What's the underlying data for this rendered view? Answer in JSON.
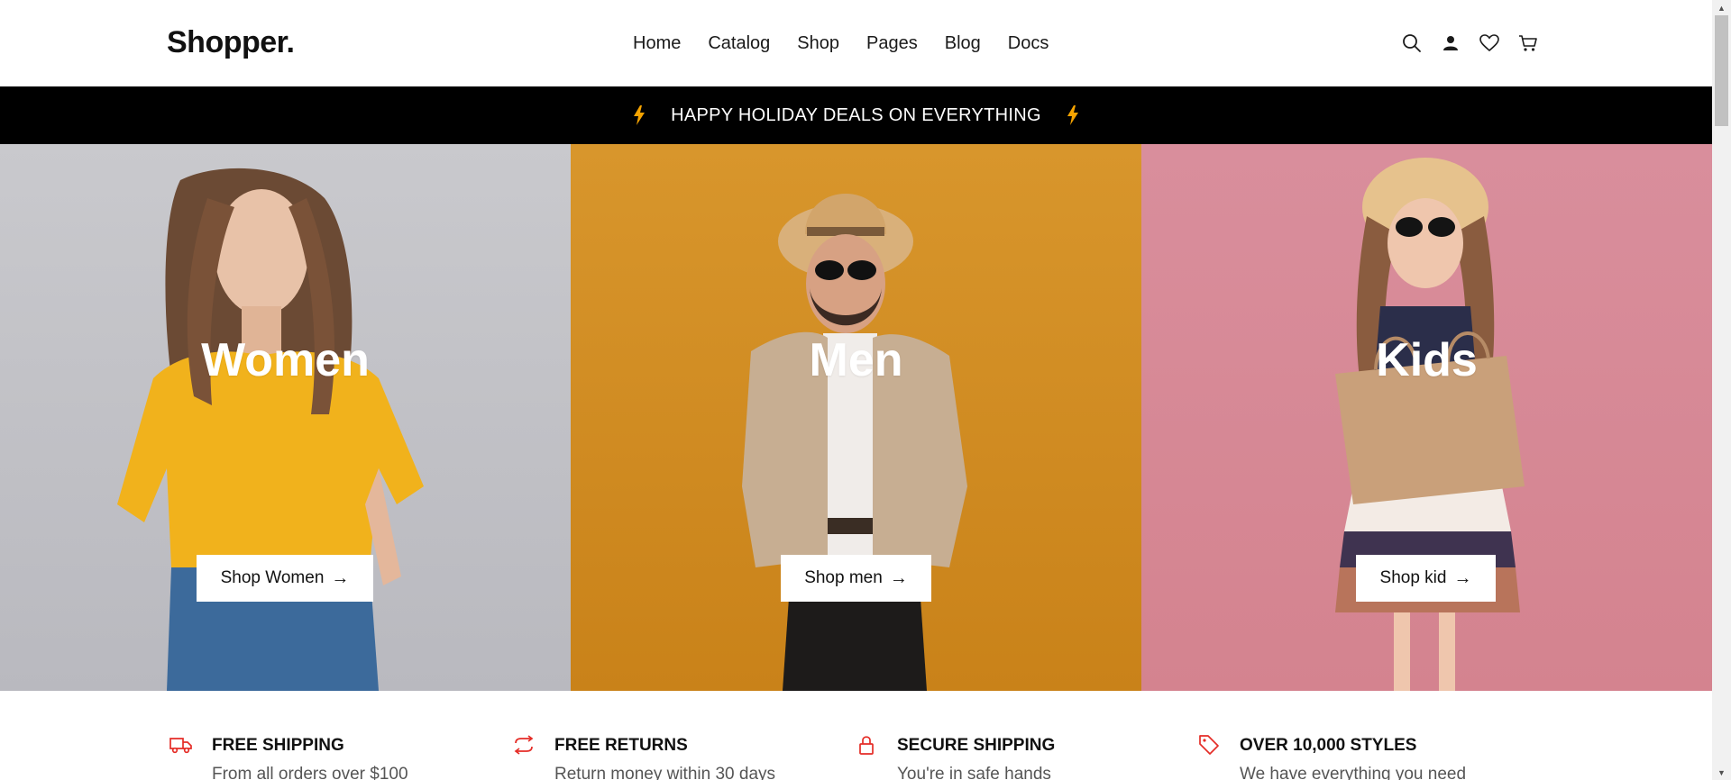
{
  "brand": {
    "logo": "Shopper."
  },
  "nav": {
    "items": [
      "Home",
      "Catalog",
      "Shop",
      "Pages",
      "Blog",
      "Docs"
    ]
  },
  "header_icons": [
    "search-icon",
    "user-icon",
    "heart-icon",
    "cart-icon"
  ],
  "promo": {
    "text": "HAPPY HOLIDAY DEALS ON EVERYTHING",
    "icon": "lightning-icon",
    "accent": "#f5a300"
  },
  "hero": {
    "panels": [
      {
        "title": "Women",
        "button": "Shop Women",
        "bg": "#bfbfc4"
      },
      {
        "title": "Men",
        "button": "Shop men",
        "bg": "#d08b22"
      },
      {
        "title": "Kids",
        "button": "Shop kid",
        "bg": "#d78896"
      }
    ],
    "arrow": "→"
  },
  "features": [
    {
      "icon": "truck-icon",
      "title": "FREE SHIPPING",
      "subtitle": "From all orders over $100"
    },
    {
      "icon": "returns-icon",
      "title": "FREE RETURNS",
      "subtitle": "Return money within 30 days"
    },
    {
      "icon": "lock-icon",
      "title": "SECURE SHIPPING",
      "subtitle": "You're in safe hands"
    },
    {
      "icon": "tag-icon",
      "title": "OVER 10,000 STYLES",
      "subtitle": "We have everything you need"
    }
  ],
  "colors": {
    "feature_icon": "#e52d27",
    "promo_bg": "#000000"
  }
}
